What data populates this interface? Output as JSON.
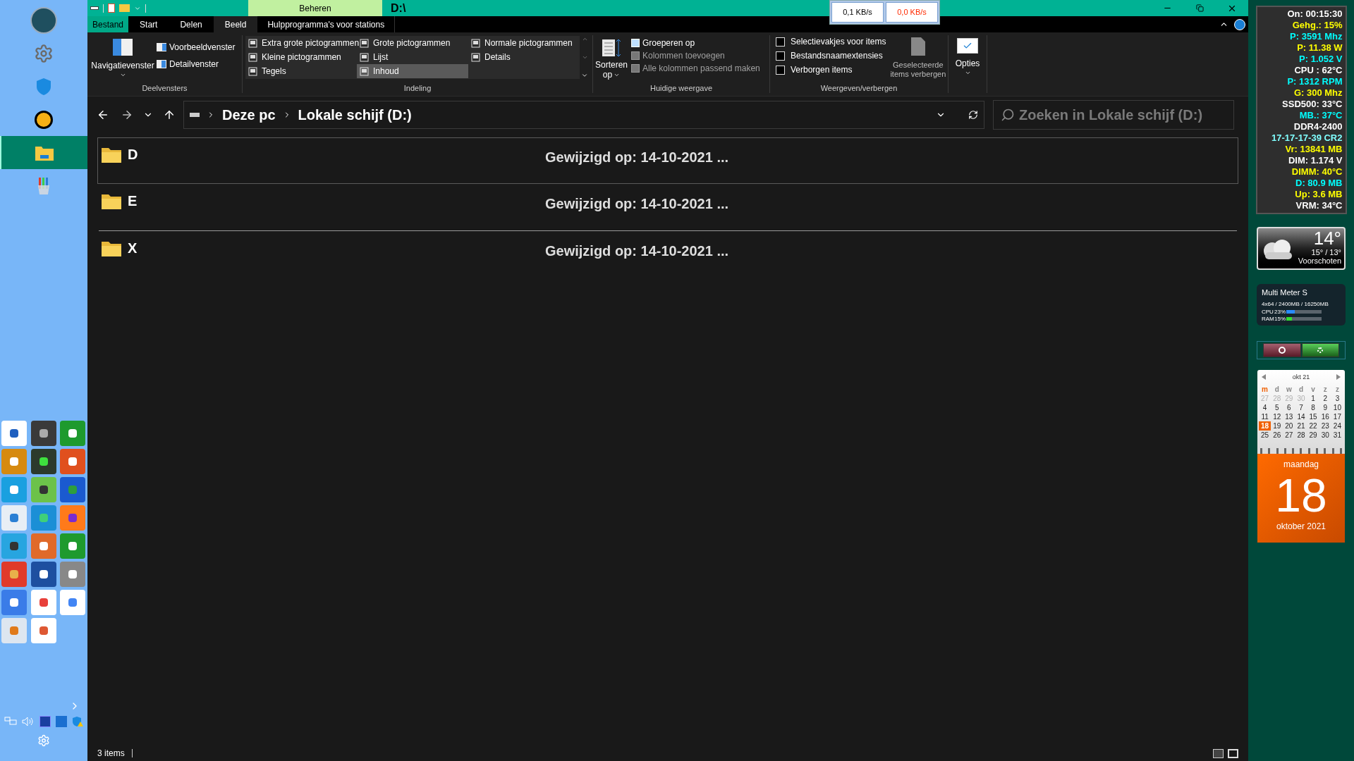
{
  "title_bar": {
    "context_tab": "Beheren",
    "title": "D:\\",
    "net_speed": [
      {
        "text": "0,1 KB/s",
        "color": "#000000"
      },
      {
        "text": "0,0 KB/s",
        "color": "#ff2a00"
      }
    ]
  },
  "ribbon_tabs": [
    {
      "label": "Bestand",
      "kind": "file",
      "selected": false
    },
    {
      "label": "Start",
      "kind": "tab",
      "selected": false
    },
    {
      "label": "Delen",
      "kind": "tab",
      "selected": false
    },
    {
      "label": "Beeld",
      "kind": "tab",
      "selected": true
    },
    {
      "label": "Hulpprogramma's voor stations",
      "kind": "context",
      "selected": false
    }
  ],
  "ribbon": {
    "panes": {
      "big": "Navigatievenster",
      "items": [
        "Voorbeeldvenster",
        "Detailvenster"
      ],
      "label": "Deelvensters"
    },
    "layout": {
      "items": [
        {
          "label": "Extra grote pictogrammen",
          "selected": false
        },
        {
          "label": "Grote pictogrammen",
          "selected": false
        },
        {
          "label": "Normale pictogrammen",
          "selected": false
        },
        {
          "label": "Kleine pictogrammen",
          "selected": false
        },
        {
          "label": "Lijst",
          "selected": false
        },
        {
          "label": "Details",
          "selected": false
        },
        {
          "label": "Tegels",
          "selected": false
        },
        {
          "label": "Inhoud",
          "selected": true
        }
      ],
      "label": "Indeling"
    },
    "current_view": {
      "sort": [
        "Sorteren",
        "op"
      ],
      "items": [
        {
          "label": "Groeperen op",
          "disabled": false
        },
        {
          "label": "Kolommen toevoegen",
          "disabled": true
        },
        {
          "label": "Alle kolommen passend maken",
          "disabled": true
        }
      ],
      "label": "Huidige weergave"
    },
    "show_hide": {
      "checkboxes": [
        {
          "label": "Selectievakjes voor items",
          "checked": false
        },
        {
          "label": "Bestandsnaamextensies",
          "checked": false
        },
        {
          "label": "Verborgen items",
          "checked": false
        }
      ],
      "hide_button": [
        "Geselecteerde",
        "items verbergen"
      ],
      "label": "Weergeven/verbergen"
    },
    "options": "Opties"
  },
  "address_bar": {
    "path": [
      "Deze pc",
      "Lokale schijf (D:)"
    ],
    "search_placeholder": "Zoeken in Lokale schijf (D:)"
  },
  "items": [
    {
      "name": "D",
      "modified": "Gewijzigd op: 14-10-2021 ...",
      "selected": true
    },
    {
      "name": "E",
      "modified": "Gewijzigd op: 14-10-2021 ...",
      "selected": false
    },
    {
      "name": "X",
      "modified": "Gewijzigd op: 14-10-2021 ...",
      "selected": false
    }
  ],
  "status_bar": {
    "count": "3 items"
  },
  "system_monitor": [
    {
      "text": "On: 00:15:30",
      "color": "#ffffff"
    },
    {
      "text": "Gehg.: 15%",
      "color": "#ffff00"
    },
    {
      "text": "P: 3591 Mhz",
      "color": "#00ffff"
    },
    {
      "text": "P: 11.38 W",
      "color": "#ffff00"
    },
    {
      "text": "P: 1.052 V",
      "color": "#00ffff"
    },
    {
      "text": "CPU : 62°C",
      "color": "#ffffff"
    },
    {
      "text": "P: 1312 RPM",
      "color": "#00ffff"
    },
    {
      "text": "G: 300 Mhz",
      "color": "#ffff00"
    },
    {
      "text": "SSD500: 33°C",
      "color": "#ffffff"
    },
    {
      "text": "MB.: 37°C",
      "color": "#00ffff"
    },
    {
      "text": "DDR4-2400",
      "color": "#ffffff"
    },
    {
      "text": "17-17-17-39 CR2",
      "color": "#80ffff"
    },
    {
      "text": "Vr: 13841 MB",
      "color": "#ffff00"
    },
    {
      "text": "DIM: 1.174 V",
      "color": "#ffffff"
    },
    {
      "text": "DIMM: 40°C",
      "color": "#ffff00"
    },
    {
      "text": "D: 80.9 MB",
      "color": "#00ffff"
    },
    {
      "text": "Up: 3.6 MB",
      "color": "#ffff00"
    },
    {
      "text": "VRM: 34°C",
      "color": "#ffffff"
    }
  ],
  "weather": {
    "temp": "14°",
    "range": "15° / 13°",
    "place": "Voorschoten"
  },
  "multi_meter": {
    "title": "Multi Meter S",
    "memory": "4x64 / 2400MB / 16250MB",
    "meters": [
      {
        "label": "CPU",
        "value": "23%",
        "level": 0.23,
        "color": "#2a8cff"
      },
      {
        "label": "RAM",
        "value": "15%",
        "level": 0.15,
        "color": "#33dd33"
      }
    ]
  },
  "calendar": {
    "month": "okt 21",
    "weekdays": [
      "m",
      "d",
      "w",
      "d",
      "v",
      "z",
      "z"
    ],
    "weeks": [
      [
        {
          "d": "27",
          "muted": true,
          "selected": false
        },
        {
          "d": "28",
          "muted": true,
          "selected": false
        },
        {
          "d": "29",
          "muted": true,
          "selected": false
        },
        {
          "d": "30",
          "muted": true,
          "selected": false
        },
        {
          "d": "1",
          "muted": false,
          "selected": false
        },
        {
          "d": "2",
          "muted": false,
          "selected": false
        },
        {
          "d": "3",
          "muted": false,
          "selected": false
        }
      ],
      [
        {
          "d": "4",
          "muted": false,
          "selected": false
        },
        {
          "d": "5",
          "muted": false,
          "selected": false
        },
        {
          "d": "6",
          "muted": false,
          "selected": false
        },
        {
          "d": "7",
          "muted": false,
          "selected": false
        },
        {
          "d": "8",
          "muted": false,
          "selected": false
        },
        {
          "d": "9",
          "muted": false,
          "selected": false
        },
        {
          "d": "10",
          "muted": false,
          "selected": false
        }
      ],
      [
        {
          "d": "11",
          "muted": false,
          "selected": false
        },
        {
          "d": "12",
          "muted": false,
          "selected": false
        },
        {
          "d": "13",
          "muted": false,
          "selected": false
        },
        {
          "d": "14",
          "muted": false,
          "selected": false
        },
        {
          "d": "15",
          "muted": false,
          "selected": false
        },
        {
          "d": "16",
          "muted": false,
          "selected": false
        },
        {
          "d": "17",
          "muted": false,
          "selected": false
        }
      ],
      [
        {
          "d": "18",
          "muted": false,
          "selected": true
        },
        {
          "d": "19",
          "muted": false,
          "selected": false
        },
        {
          "d": "20",
          "muted": false,
          "selected": false
        },
        {
          "d": "21",
          "muted": false,
          "selected": false
        },
        {
          "d": "22",
          "muted": false,
          "selected": false
        },
        {
          "d": "23",
          "muted": false,
          "selected": false
        },
        {
          "d": "24",
          "muted": false,
          "selected": false
        }
      ],
      [
        {
          "d": "25",
          "muted": false,
          "selected": false
        },
        {
          "d": "26",
          "muted": false,
          "selected": false
        },
        {
          "d": "27",
          "muted": false,
          "selected": false
        },
        {
          "d": "28",
          "muted": false,
          "selected": false
        },
        {
          "d": "29",
          "muted": false,
          "selected": false
        },
        {
          "d": "30",
          "muted": false,
          "selected": false
        },
        {
          "d": "31",
          "muted": false,
          "selected": false
        }
      ]
    ],
    "day_name": "maandag",
    "day": "18",
    "month_year": "oktober 2021"
  }
}
